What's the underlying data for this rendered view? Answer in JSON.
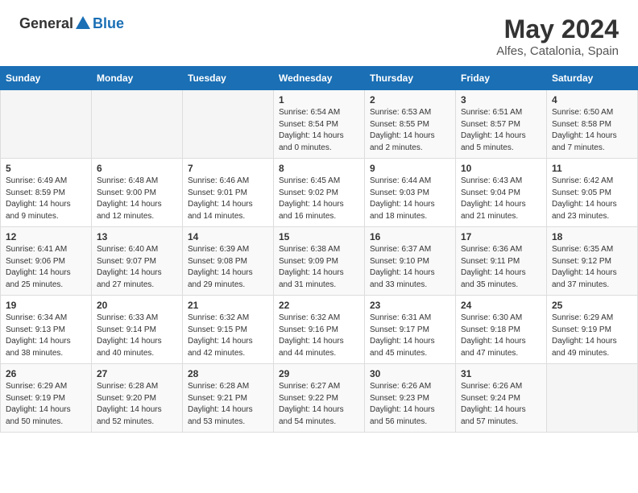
{
  "header": {
    "logo_general": "General",
    "logo_blue": "Blue",
    "month_year": "May 2024",
    "location": "Alfes, Catalonia, Spain"
  },
  "days_of_week": [
    "Sunday",
    "Monday",
    "Tuesday",
    "Wednesday",
    "Thursday",
    "Friday",
    "Saturday"
  ],
  "weeks": [
    [
      {
        "day": "",
        "sunrise": "",
        "sunset": "",
        "daylight": "",
        "empty": true
      },
      {
        "day": "",
        "sunrise": "",
        "sunset": "",
        "daylight": "",
        "empty": true
      },
      {
        "day": "",
        "sunrise": "",
        "sunset": "",
        "daylight": "",
        "empty": true
      },
      {
        "day": "1",
        "sunrise": "Sunrise: 6:54 AM",
        "sunset": "Sunset: 8:54 PM",
        "daylight": "Daylight: 14 hours and 0 minutes."
      },
      {
        "day": "2",
        "sunrise": "Sunrise: 6:53 AM",
        "sunset": "Sunset: 8:55 PM",
        "daylight": "Daylight: 14 hours and 2 minutes."
      },
      {
        "day": "3",
        "sunrise": "Sunrise: 6:51 AM",
        "sunset": "Sunset: 8:57 PM",
        "daylight": "Daylight: 14 hours and 5 minutes."
      },
      {
        "day": "4",
        "sunrise": "Sunrise: 6:50 AM",
        "sunset": "Sunset: 8:58 PM",
        "daylight": "Daylight: 14 hours and 7 minutes."
      }
    ],
    [
      {
        "day": "5",
        "sunrise": "Sunrise: 6:49 AM",
        "sunset": "Sunset: 8:59 PM",
        "daylight": "Daylight: 14 hours and 9 minutes."
      },
      {
        "day": "6",
        "sunrise": "Sunrise: 6:48 AM",
        "sunset": "Sunset: 9:00 PM",
        "daylight": "Daylight: 14 hours and 12 minutes."
      },
      {
        "day": "7",
        "sunrise": "Sunrise: 6:46 AM",
        "sunset": "Sunset: 9:01 PM",
        "daylight": "Daylight: 14 hours and 14 minutes."
      },
      {
        "day": "8",
        "sunrise": "Sunrise: 6:45 AM",
        "sunset": "Sunset: 9:02 PM",
        "daylight": "Daylight: 14 hours and 16 minutes."
      },
      {
        "day": "9",
        "sunrise": "Sunrise: 6:44 AM",
        "sunset": "Sunset: 9:03 PM",
        "daylight": "Daylight: 14 hours and 18 minutes."
      },
      {
        "day": "10",
        "sunrise": "Sunrise: 6:43 AM",
        "sunset": "Sunset: 9:04 PM",
        "daylight": "Daylight: 14 hours and 21 minutes."
      },
      {
        "day": "11",
        "sunrise": "Sunrise: 6:42 AM",
        "sunset": "Sunset: 9:05 PM",
        "daylight": "Daylight: 14 hours and 23 minutes."
      }
    ],
    [
      {
        "day": "12",
        "sunrise": "Sunrise: 6:41 AM",
        "sunset": "Sunset: 9:06 PM",
        "daylight": "Daylight: 14 hours and 25 minutes."
      },
      {
        "day": "13",
        "sunrise": "Sunrise: 6:40 AM",
        "sunset": "Sunset: 9:07 PM",
        "daylight": "Daylight: 14 hours and 27 minutes."
      },
      {
        "day": "14",
        "sunrise": "Sunrise: 6:39 AM",
        "sunset": "Sunset: 9:08 PM",
        "daylight": "Daylight: 14 hours and 29 minutes."
      },
      {
        "day": "15",
        "sunrise": "Sunrise: 6:38 AM",
        "sunset": "Sunset: 9:09 PM",
        "daylight": "Daylight: 14 hours and 31 minutes."
      },
      {
        "day": "16",
        "sunrise": "Sunrise: 6:37 AM",
        "sunset": "Sunset: 9:10 PM",
        "daylight": "Daylight: 14 hours and 33 minutes."
      },
      {
        "day": "17",
        "sunrise": "Sunrise: 6:36 AM",
        "sunset": "Sunset: 9:11 PM",
        "daylight": "Daylight: 14 hours and 35 minutes."
      },
      {
        "day": "18",
        "sunrise": "Sunrise: 6:35 AM",
        "sunset": "Sunset: 9:12 PM",
        "daylight": "Daylight: 14 hours and 37 minutes."
      }
    ],
    [
      {
        "day": "19",
        "sunrise": "Sunrise: 6:34 AM",
        "sunset": "Sunset: 9:13 PM",
        "daylight": "Daylight: 14 hours and 38 minutes."
      },
      {
        "day": "20",
        "sunrise": "Sunrise: 6:33 AM",
        "sunset": "Sunset: 9:14 PM",
        "daylight": "Daylight: 14 hours and 40 minutes."
      },
      {
        "day": "21",
        "sunrise": "Sunrise: 6:32 AM",
        "sunset": "Sunset: 9:15 PM",
        "daylight": "Daylight: 14 hours and 42 minutes."
      },
      {
        "day": "22",
        "sunrise": "Sunrise: 6:32 AM",
        "sunset": "Sunset: 9:16 PM",
        "daylight": "Daylight: 14 hours and 44 minutes."
      },
      {
        "day": "23",
        "sunrise": "Sunrise: 6:31 AM",
        "sunset": "Sunset: 9:17 PM",
        "daylight": "Daylight: 14 hours and 45 minutes."
      },
      {
        "day": "24",
        "sunrise": "Sunrise: 6:30 AM",
        "sunset": "Sunset: 9:18 PM",
        "daylight": "Daylight: 14 hours and 47 minutes."
      },
      {
        "day": "25",
        "sunrise": "Sunrise: 6:29 AM",
        "sunset": "Sunset: 9:19 PM",
        "daylight": "Daylight: 14 hours and 49 minutes."
      }
    ],
    [
      {
        "day": "26",
        "sunrise": "Sunrise: 6:29 AM",
        "sunset": "Sunset: 9:19 PM",
        "daylight": "Daylight: 14 hours and 50 minutes."
      },
      {
        "day": "27",
        "sunrise": "Sunrise: 6:28 AM",
        "sunset": "Sunset: 9:20 PM",
        "daylight": "Daylight: 14 hours and 52 minutes."
      },
      {
        "day": "28",
        "sunrise": "Sunrise: 6:28 AM",
        "sunset": "Sunset: 9:21 PM",
        "daylight": "Daylight: 14 hours and 53 minutes."
      },
      {
        "day": "29",
        "sunrise": "Sunrise: 6:27 AM",
        "sunset": "Sunset: 9:22 PM",
        "daylight": "Daylight: 14 hours and 54 minutes."
      },
      {
        "day": "30",
        "sunrise": "Sunrise: 6:26 AM",
        "sunset": "Sunset: 9:23 PM",
        "daylight": "Daylight: 14 hours and 56 minutes."
      },
      {
        "day": "31",
        "sunrise": "Sunrise: 6:26 AM",
        "sunset": "Sunset: 9:24 PM",
        "daylight": "Daylight: 14 hours and 57 minutes."
      },
      {
        "day": "",
        "sunrise": "",
        "sunset": "",
        "daylight": "",
        "empty": true
      }
    ]
  ]
}
